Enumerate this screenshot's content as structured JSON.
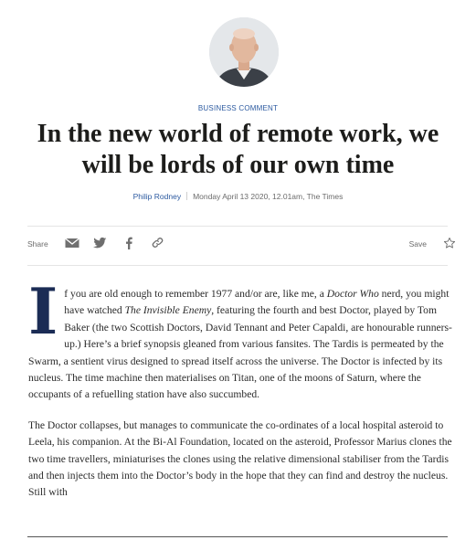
{
  "article": {
    "section": "BUSINESS COMMENT",
    "headline": "In the new world of remote work, we will be lords of our own time",
    "author": "Philip Rodney",
    "timestamp": "Monday April 13 2020, 12.01am, The Times"
  },
  "share_bar": {
    "share_label": "Share",
    "save_label": "Save",
    "icons": [
      "email-icon",
      "twitter-icon",
      "facebook-icon",
      "link-icon",
      "star-icon"
    ]
  },
  "body": {
    "p1_dropcap": "I",
    "p1_a": "f you are old enough to remember 1977 and/or are, like me, a ",
    "p1_i1": "Doctor Who",
    "p1_b": " nerd, you might have watched ",
    "p1_i2": "The Invisible Enemy",
    "p1_c": ", featuring the fourth and best Doctor, played by Tom Baker (the two Scottish Doctors, David Tennant and Peter Capaldi, are honourable runners-up.) Here’s a brief synopsis gleaned from various fansites. The Tardis is permeated by the Swarm, a sentient virus designed to spread itself across the universe. The Doctor is infected by its nucleus. The time machine then materialises on Titan, one of the moons of Saturn, where the occupants of a refuelling station have also succumbed.",
    "p2": "The Doctor collapses, but manages to communicate the co-ordinates of a local hospital asteroid to Leela, his companion. At the Bi-Al Foundation, located on the asteroid, Professor Marius clones the two time travellers, miniaturises the clones using the relative dimensional stabiliser from the Tardis and then injects them into the Doctor’s body in the hope that they can find and destroy the nucleus. Still with"
  },
  "colors": {
    "accent": "#2c5aa0",
    "dropcap": "#1b2c55",
    "text": "#2b2b2b"
  }
}
